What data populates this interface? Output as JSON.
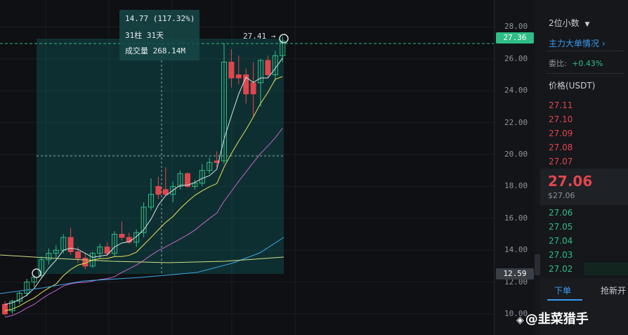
{
  "chart": {
    "measure": {
      "change": "14.77 (117.32%)",
      "bars": "31柱 31天",
      "volume": "成交量 268.14M"
    },
    "peak_label": "27.41 →",
    "y_ticks": [
      "28.00",
      "26.00",
      "24.00",
      "22.00",
      "20.00",
      "18.00",
      "16.00",
      "14.00",
      "12.00",
      "10.00"
    ],
    "current_price_tag": "27.36",
    "range_low_tag": "12.59",
    "colors": {
      "up": "#2ebd85",
      "down": "#e0464e",
      "ma7": "#d7e3ea",
      "ma25": "#e8e25a",
      "ma99": "#c564c9",
      "ma_blue": "#3fa3e0",
      "ma_yellow_flat": "#cfe08a",
      "selection": "#0f6b6b"
    }
  },
  "chart_data": {
    "type": "candlestick",
    "ylim": [
      10,
      28
    ],
    "candles": [
      {
        "o": 10.0,
        "h": 10.8,
        "l": 9.9,
        "c": 10.6,
        "dir": "down"
      },
      {
        "o": 10.2,
        "h": 10.9,
        "l": 10.0,
        "c": 10.8,
        "dir": "up"
      },
      {
        "o": 10.8,
        "h": 11.4,
        "l": 10.6,
        "c": 11.3,
        "dir": "up"
      },
      {
        "o": 11.3,
        "h": 12.2,
        "l": 11.1,
        "c": 12.0,
        "dir": "up"
      },
      {
        "o": 12.0,
        "h": 12.4,
        "l": 11.7,
        "c": 12.3,
        "dir": "up"
      },
      {
        "o": 12.4,
        "h": 13.6,
        "l": 12.2,
        "c": 13.4,
        "dir": "up"
      },
      {
        "o": 13.4,
        "h": 14.1,
        "l": 13.1,
        "c": 13.8,
        "dir": "up"
      },
      {
        "o": 13.8,
        "h": 14.3,
        "l": 13.5,
        "c": 14.0,
        "dir": "up"
      },
      {
        "o": 14.0,
        "h": 15.0,
        "l": 13.8,
        "c": 14.8,
        "dir": "up"
      },
      {
        "o": 14.8,
        "h": 15.4,
        "l": 13.7,
        "c": 13.9,
        "dir": "down"
      },
      {
        "o": 13.9,
        "h": 14.2,
        "l": 13.2,
        "c": 13.5,
        "dir": "down"
      },
      {
        "o": 13.5,
        "h": 13.8,
        "l": 12.8,
        "c": 13.0,
        "dir": "down"
      },
      {
        "o": 13.0,
        "h": 13.9,
        "l": 12.9,
        "c": 13.8,
        "dir": "up"
      },
      {
        "o": 13.8,
        "h": 14.4,
        "l": 13.5,
        "c": 14.2,
        "dir": "up"
      },
      {
        "o": 14.2,
        "h": 14.5,
        "l": 13.6,
        "c": 13.8,
        "dir": "down"
      },
      {
        "o": 13.8,
        "h": 15.2,
        "l": 13.6,
        "c": 15.0,
        "dir": "up"
      },
      {
        "o": 15.0,
        "h": 15.8,
        "l": 14.6,
        "c": 14.8,
        "dir": "down"
      },
      {
        "o": 14.8,
        "h": 15.1,
        "l": 14.4,
        "c": 14.5,
        "dir": "down"
      },
      {
        "o": 14.5,
        "h": 15.3,
        "l": 14.2,
        "c": 15.1,
        "dir": "up"
      },
      {
        "o": 15.1,
        "h": 17.0,
        "l": 14.8,
        "c": 16.7,
        "dir": "up"
      },
      {
        "o": 16.7,
        "h": 18.5,
        "l": 16.5,
        "c": 17.5,
        "dir": "up"
      },
      {
        "o": 17.5,
        "h": 18.6,
        "l": 17.2,
        "c": 18.0,
        "dir": "down"
      },
      {
        "o": 17.8,
        "h": 19.2,
        "l": 17.4,
        "c": 17.5,
        "dir": "down"
      },
      {
        "o": 17.5,
        "h": 18.3,
        "l": 17.0,
        "c": 18.0,
        "dir": "up"
      },
      {
        "o": 18.0,
        "h": 19.0,
        "l": 17.8,
        "c": 18.8,
        "dir": "up"
      },
      {
        "o": 18.8,
        "h": 18.9,
        "l": 17.9,
        "c": 18.0,
        "dir": "down"
      },
      {
        "o": 18.0,
        "h": 18.4,
        "l": 17.8,
        "c": 18.2,
        "dir": "up"
      },
      {
        "o": 18.2,
        "h": 19.4,
        "l": 18.0,
        "c": 19.0,
        "dir": "up"
      },
      {
        "o": 19.0,
        "h": 19.8,
        "l": 18.8,
        "c": 19.5,
        "dir": "up"
      },
      {
        "o": 19.5,
        "h": 20.2,
        "l": 19.2,
        "c": 19.6,
        "dir": "down"
      },
      {
        "o": 19.6,
        "h": 27.0,
        "l": 19.4,
        "c": 25.8,
        "dir": "up"
      },
      {
        "o": 25.8,
        "h": 26.6,
        "l": 24.2,
        "c": 24.8,
        "dir": "down"
      },
      {
        "o": 24.8,
        "h": 26.2,
        "l": 24.4,
        "c": 25.0,
        "dir": "down"
      },
      {
        "o": 25.0,
        "h": 25.4,
        "l": 23.2,
        "c": 23.8,
        "dir": "down"
      },
      {
        "o": 23.8,
        "h": 25.8,
        "l": 22.4,
        "c": 24.5,
        "dir": "down"
      },
      {
        "o": 24.5,
        "h": 26.0,
        "l": 23.0,
        "c": 25.9,
        "dir": "up"
      },
      {
        "o": 25.9,
        "h": 26.2,
        "l": 24.8,
        "c": 25.0,
        "dir": "down"
      },
      {
        "o": 25.0,
        "h": 26.5,
        "l": 24.6,
        "c": 26.2,
        "dir": "up"
      },
      {
        "o": 26.2,
        "h": 27.4,
        "l": 25.8,
        "c": 27.1,
        "dir": "up"
      }
    ]
  },
  "sidebar": {
    "precision": "2位小数",
    "main_orders": "主力大单情况",
    "ratio_label": "委比:",
    "ratio_value": "+0.43%",
    "price_label": "价格(USDT)",
    "asks": [
      "27.11",
      "27.10",
      "27.09",
      "27.08",
      "27.07"
    ],
    "last_price": "27.06",
    "last_price_usd": "$27.06",
    "bids": [
      "27.06",
      "27.05",
      "27.04",
      "27.03",
      "27.02"
    ],
    "tab_order": "下单",
    "tab_grab": "抢新开"
  },
  "watermark": "@韭菜猎手"
}
